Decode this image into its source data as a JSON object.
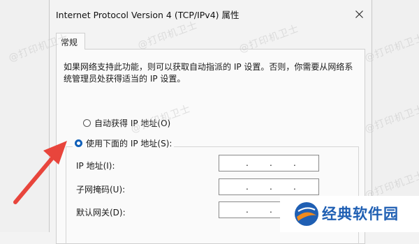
{
  "watermark": "@打印机卫士",
  "dialog": {
    "title": "Internet Protocol Version 4 (TCP/IPv4) 属性",
    "tab_general": "常规",
    "description": "如果网络支持此功能，则可以获取自动指派的 IP 设置。否则，你需要从网络系统管理员处获得适当的 IP 设置。",
    "auto_ip_label": "自动获得 IP 地址(O)",
    "manual_ip_label": "使用下面的 IP 地址(S):",
    "ip_address_label": "IP 地址(I):",
    "subnet_mask_label": "子网掩码(U):",
    "gateway_label": "默认网关(D):",
    "ip_dot": "."
  },
  "badge": {
    "text": "经典软件园"
  },
  "colors": {
    "accent": "#0f5fb8",
    "arrow": "#e8453c",
    "badge_blue": "#1f5fb3",
    "badge_orange": "#f08a1c"
  }
}
